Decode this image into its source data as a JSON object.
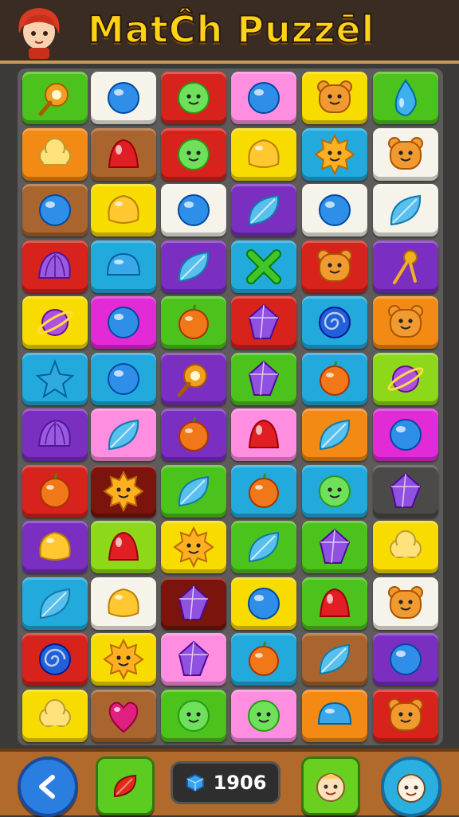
{
  "header": {
    "title": "MatĈh Puzzēl"
  },
  "footer": {
    "score": "1906"
  },
  "colors": {
    "G": "#4cc21d",
    "W": "#f6f3ea",
    "R": "#d8221c",
    "P": "#ff8de0",
    "Y": "#f8dc00",
    "C": "#22aadd",
    "O": "#f28a14",
    "B": "#a9652d",
    "V": "#7b2fc0",
    "M": "#e22ad6",
    "D": "#7a140c",
    "K": "#4c4a48",
    "L": "#8ed81a"
  },
  "board": {
    "rows": [
      [
        [
          "G",
          "key-icon"
        ],
        [
          "W",
          "ball-icon"
        ],
        [
          "R",
          "face-icon"
        ],
        [
          "P",
          "ball-icon"
        ],
        [
          "Y",
          "bear-icon"
        ],
        [
          "G",
          "drop-icon"
        ]
      ],
      [
        [
          "O",
          "cloud-icon"
        ],
        [
          "B",
          "gumdrop-icon"
        ],
        [
          "R",
          "face-icon"
        ],
        [
          "Y",
          "blob-icon"
        ],
        [
          "C",
          "sun-icon"
        ],
        [
          "W",
          "bear-icon"
        ]
      ],
      [
        [
          "B",
          "ball-icon"
        ],
        [
          "Y",
          "blob-icon"
        ],
        [
          "W",
          "ball-icon"
        ],
        [
          "V",
          "leaf-icon"
        ],
        [
          "W",
          "ball-icon"
        ],
        [
          "W",
          "leaf-icon"
        ]
      ],
      [
        [
          "R",
          "shell-icon"
        ],
        [
          "C",
          "dome-icon"
        ],
        [
          "V",
          "leaf-icon"
        ],
        [
          "C",
          "cross-icon"
        ],
        [
          "R",
          "bear-icon"
        ],
        [
          "V",
          "pin-icon"
        ]
      ],
      [
        [
          "Y",
          "planet-icon"
        ],
        [
          "M",
          "ball-icon"
        ],
        [
          "G",
          "orange-icon"
        ],
        [
          "R",
          "crystal-icon"
        ],
        [
          "C",
          "swirl-icon"
        ],
        [
          "O",
          "bear-icon"
        ]
      ],
      [
        [
          "C",
          "star-icon"
        ],
        [
          "C",
          "ball-icon"
        ],
        [
          "V",
          "key-icon"
        ],
        [
          "G",
          "crystal-icon"
        ],
        [
          "C",
          "orange-icon"
        ],
        [
          "L",
          "planet-icon"
        ]
      ],
      [
        [
          "V",
          "shell-icon"
        ],
        [
          "P",
          "leaf-icon"
        ],
        [
          "V",
          "orange-icon"
        ],
        [
          "P",
          "gumdrop-icon"
        ],
        [
          "O",
          "leaf-icon"
        ],
        [
          "M",
          "ball-icon"
        ]
      ],
      [
        [
          "R",
          "orange-icon"
        ],
        [
          "D",
          "sun-icon"
        ],
        [
          "G",
          "leaf-icon"
        ],
        [
          "C",
          "orange-icon"
        ],
        [
          "C",
          "face-icon"
        ],
        [
          "K",
          "crystal-icon"
        ]
      ],
      [
        [
          "V",
          "blob-icon"
        ],
        [
          "L",
          "gumdrop-icon"
        ],
        [
          "Y",
          "sun-icon"
        ],
        [
          "G",
          "leaf-icon"
        ],
        [
          "G",
          "crystal-icon"
        ],
        [
          "Y",
          "cloud-icon"
        ]
      ],
      [
        [
          "C",
          "leaf-icon"
        ],
        [
          "W",
          "blob-icon"
        ],
        [
          "D",
          "crystal-icon"
        ],
        [
          "Y",
          "ball-icon"
        ],
        [
          "G",
          "gumdrop-icon"
        ],
        [
          "W",
          "bear-icon"
        ]
      ],
      [
        [
          "R",
          "swirl-icon"
        ],
        [
          "Y",
          "sun-icon"
        ],
        [
          "P",
          "crystal-icon"
        ],
        [
          "C",
          "orange-icon"
        ],
        [
          "B",
          "leaf-icon"
        ],
        [
          "V",
          "ball-icon"
        ]
      ],
      [
        [
          "Y",
          "cloud-icon"
        ],
        [
          "B",
          "heart-icon"
        ],
        [
          "G",
          "face-icon"
        ],
        [
          "P",
          "face-icon"
        ],
        [
          "O",
          "dome-icon"
        ],
        [
          "R",
          "bear-icon"
        ]
      ]
    ]
  },
  "icons": {
    "key-icon": "#f0a020",
    "ball-icon": "#2f8fe8",
    "face-icon": "#6ee05a",
    "bear-icon": "#f09a30",
    "drop-icon": "#3fb0ee",
    "cloud-icon": "#ffe27a",
    "gumdrop-icon": "#e01e24",
    "blob-icon": "#ffc830",
    "sun-icon": "#ffb020",
    "leaf-icon": "#58c0ee",
    "shell-icon": "#9a5ae0",
    "dome-icon": "#3aa8e8",
    "cross-icon": "#42c42a",
    "pin-icon": "#f0b020",
    "planet-icon": "#b050e0",
    "orange-icon": "#f07818",
    "crystal-icon": "#9050e0",
    "swirl-icon": "#2060d8",
    "star-icon": "#30a8e0",
    "heart-icon": "#e02080"
  }
}
